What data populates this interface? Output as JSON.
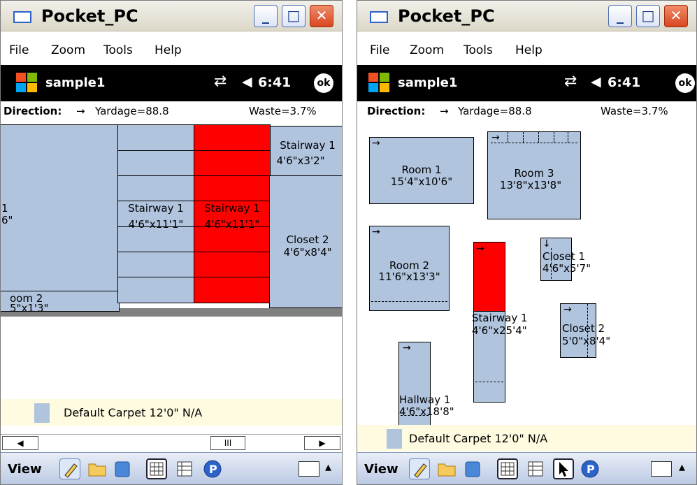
{
  "windows": [
    {
      "title": "Pocket_PC",
      "menu": [
        "File",
        "Zoom",
        "Tools",
        "Help"
      ],
      "app_name": "sample1",
      "time": "6:41",
      "ok_label": "ok",
      "direction_label": "Direction:",
      "direction_arrow": "→",
      "yardage": "Yardage=88.8",
      "waste": "Waste=3.7%",
      "pieces": {
        "room1_partial": [
          "1",
          "6\""
        ],
        "stairway_a": [
          "Stairway 1",
          "4'6\"x11'1\""
        ],
        "stairway_b": [
          "Stairway 1",
          "4'6\"x11'1\""
        ],
        "stairway_top": [
          "Stairway 1",
          "4'6\"x3'2\""
        ],
        "closet2": [
          "Closet 2",
          "4'6\"x8'4\""
        ],
        "room2_partial": [
          "oom 2",
          "5\"x1'3\""
        ]
      },
      "legend": "Default Carpet 12'0\" N/A",
      "scroll_thumb": "III",
      "view_label": "View"
    },
    {
      "title": "Pocket_PC",
      "menu": [
        "File",
        "Zoom",
        "Tools",
        "Help"
      ],
      "app_name": "sample1",
      "time": "6:41",
      "ok_label": "ok",
      "direction_label": "Direction:",
      "direction_arrow": "→",
      "yardage": "Yardage=88.8",
      "waste": "Waste=3.7%",
      "pieces": {
        "room1": [
          "Room 1",
          "15'4\"x10'6\""
        ],
        "room3": [
          "Room 3",
          "13'8\"x13'8\""
        ],
        "room2": [
          "Room 2",
          "11'6\"x13'3\""
        ],
        "stairway1": [
          "Stairway 1",
          "4'6\"x25'4\""
        ],
        "closet1": [
          "Closet 1",
          "4'6\"x5'7\""
        ],
        "closet2": [
          "Closet 2",
          "5'0\"x8'4\""
        ],
        "hallway1": [
          "Hallway 1",
          "4'6\"x18'8\""
        ]
      },
      "legend": "Default Carpet 12'0\" N/A",
      "view_label": "View"
    }
  ],
  "colors": {
    "carpet": "#b0c4de",
    "selected": "#ff0000",
    "cmdbar": "#000000",
    "legend_bg": "#fffbe0"
  },
  "icons": [
    "windows-flag-icon",
    "connectivity-icon",
    "volume-icon",
    "pen-icon",
    "folder-icon",
    "book-icon",
    "grid-view-icon",
    "list-view-icon",
    "pointer-icon",
    "p-icon",
    "keyboard-icon",
    "chevron-up-icon"
  ]
}
